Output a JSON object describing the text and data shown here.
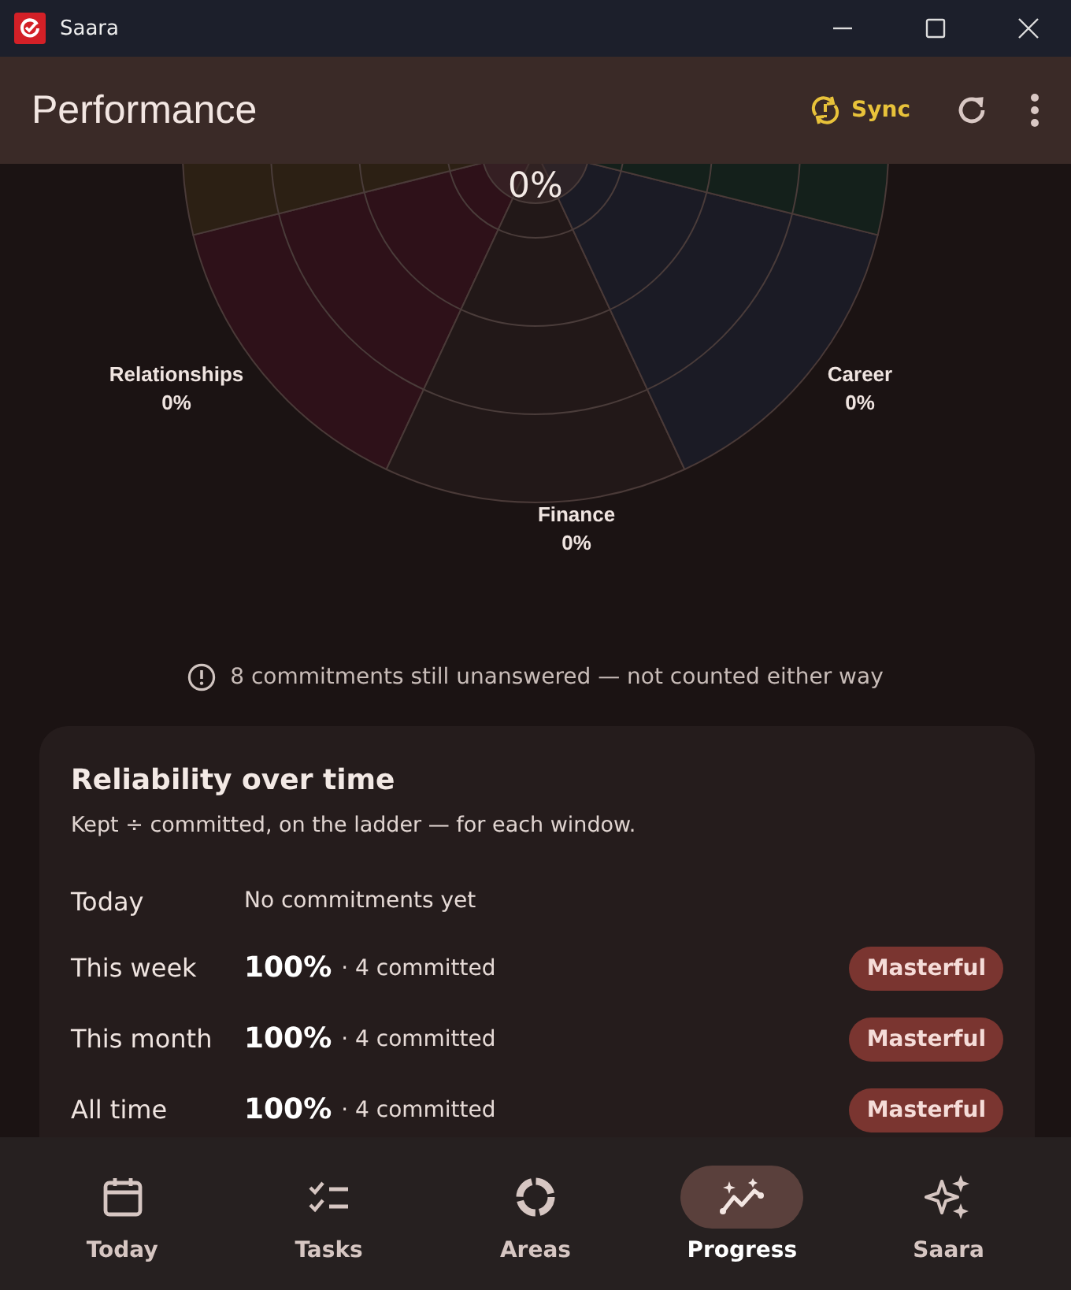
{
  "window": {
    "title": "Saara"
  },
  "header": {
    "title": "Performance",
    "sync_label": "Sync"
  },
  "chart": {
    "center_value": "0%",
    "sectors": [
      {
        "color": "#2e1119"
      },
      {
        "color": "#221818"
      },
      {
        "color": "#1b1b25"
      },
      {
        "color": "#14201b"
      },
      {
        "color": "#2c2014"
      }
    ],
    "labels": [
      {
        "name": "Relationships",
        "value": "0%"
      },
      {
        "name": "Finance",
        "value": "0%"
      },
      {
        "name": "Career",
        "value": "0%"
      }
    ]
  },
  "notice": "8 commitments still unanswered — not counted either way",
  "reliability": {
    "title": "Reliability over time",
    "subtitle": "Kept ÷ committed, on the ladder — for each window.",
    "rows": [
      {
        "kind": "empty",
        "period": "Today",
        "detail": "No commitments yet"
      },
      {
        "kind": "rated",
        "period": "This week",
        "percent": "100%",
        "detail": "· 4 committed",
        "badge": "Masterful"
      },
      {
        "kind": "rated",
        "period": "This month",
        "percent": "100%",
        "detail": "· 4 committed",
        "badge": "Masterful"
      },
      {
        "kind": "rated",
        "period": "All time",
        "percent": "100%",
        "detail": "· 4 committed",
        "badge": "Masterful"
      }
    ]
  },
  "nav": [
    {
      "label": "Today",
      "selected": false
    },
    {
      "label": "Tasks",
      "selected": false
    },
    {
      "label": "Areas",
      "selected": false
    },
    {
      "label": "Progress",
      "selected": true
    },
    {
      "label": "Saara",
      "selected": false
    }
  ]
}
